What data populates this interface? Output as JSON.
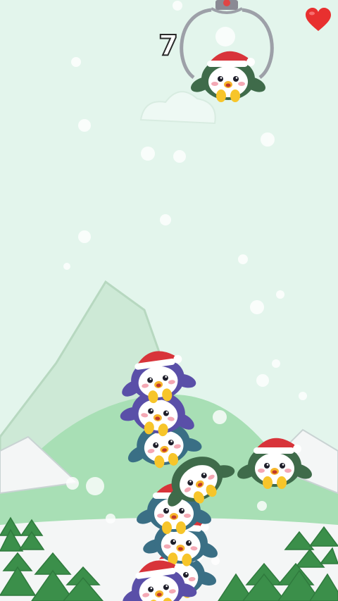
{
  "hud": {
    "score": "7",
    "lives_icon": "heart-icon"
  },
  "colors": {
    "sky": "#e3f5ec",
    "mountain": "#cde9d6",
    "hill": "#a8dfb5",
    "snow": "#f4f6f6",
    "tree": "#3b8f4a",
    "heart": "#e8302f",
    "santa_hat": "#d8343a",
    "penguin_purple": "#5a4fa8",
    "penguin_teal": "#3a6f85",
    "penguin_green": "#3f6b4a"
  },
  "scene": {
    "crane": "claw-icon",
    "held_penguin": {
      "color": "green",
      "hat": true
    },
    "waiting_penguin": {
      "color": "green",
      "hat": true
    },
    "stack": [
      {
        "color": "purple",
        "hat": true
      },
      {
        "color": "purple",
        "hat": false
      },
      {
        "color": "teal",
        "hat": false
      },
      {
        "color": "green",
        "hat": false
      },
      {
        "color": "teal",
        "hat": true
      },
      {
        "color": "teal",
        "hat": true
      },
      {
        "color": "purple",
        "hat": true
      }
    ]
  }
}
